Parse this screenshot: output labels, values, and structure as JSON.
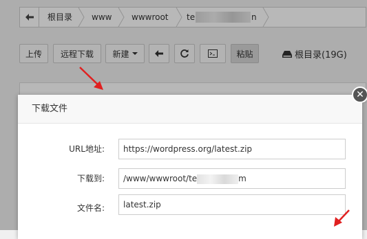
{
  "breadcrumb": {
    "items": [
      "根目录",
      "www",
      "wwwroot",
      "te",
      "n"
    ]
  },
  "toolbar": {
    "upload": "上传",
    "remote_download": "远程下载",
    "new": "新建",
    "paste": "粘贴",
    "disk_label": "根目录(19G)"
  },
  "modal": {
    "title": "下载文件",
    "close_glyph": "✕",
    "url_label": "URL地址:",
    "url_value": "https://wordpress.org/latest.zip",
    "dest_label": "下载到:",
    "dest_value_prefix": "/www/wwwroot/te",
    "dest_value_suffix": "m",
    "filename_label": "文件名:",
    "filename_value": "latest.zip"
  },
  "colors": {
    "annotation_arrow": "#e02020",
    "overlay": "rgba(0,0,0,0.28)"
  }
}
